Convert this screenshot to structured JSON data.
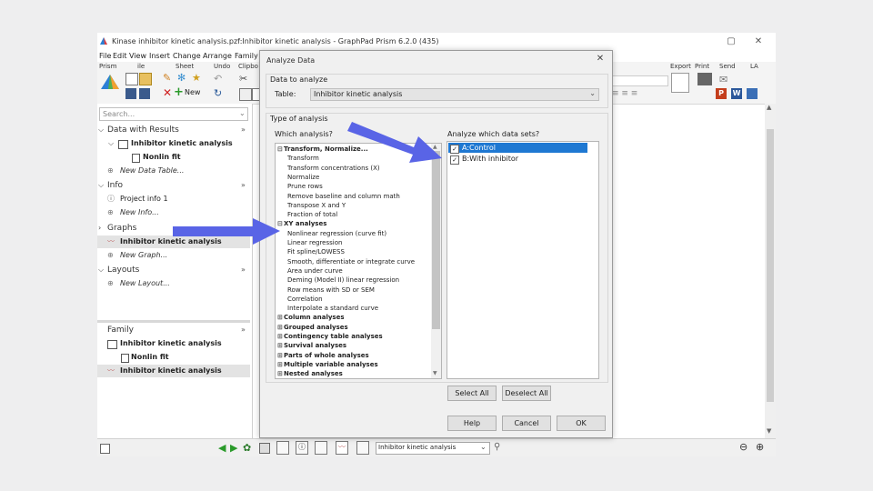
{
  "app": {
    "title": "Kinase inhibitor kinetic analysis.pzf:Inhibitor kinetic analysis - GraphPad Prism 6.2.0 (435)",
    "menu": [
      "File",
      "Edit",
      "View",
      "Insert",
      "Change",
      "Arrange",
      "Family"
    ],
    "ribbon_labels": {
      "prism": "Prism",
      "file": "ile",
      "sheet": "Sheet",
      "undo": "Undo",
      "clipboard": "Clipbo",
      "export": "Export",
      "print": "Print",
      "send": "Send",
      "la": "LA"
    },
    "new_label": "New"
  },
  "navigator": {
    "search_placeholder": "Search...",
    "sections": {
      "data": "Data with Results",
      "info": "Info",
      "graphs": "Graphs",
      "layouts": "Layouts",
      "family": "Family"
    },
    "data_table": "Inhibitor kinetic analysis",
    "nonlin_fit": "Nonlin fit",
    "new_data_table": "New Data Table...",
    "project_info": "Project info 1",
    "new_info": "New Info...",
    "graph_item": "Inhibitor kinetic analysis",
    "new_graph": "New Graph...",
    "new_layout": "New Layout...",
    "family_items": [
      "Inhibitor kinetic analysis",
      "Nonlin fit",
      "Inhibitor kinetic analysis"
    ],
    "collapse": "»"
  },
  "statusbar": {
    "sheet_select": "Inhibitor kinetic analysis"
  },
  "dialog": {
    "title": "Analyze Data",
    "data_to_analyze": "Data to analyze",
    "table_label": "Table:",
    "table_value": "Inhibitor kinetic analysis",
    "type_of_analysis": "Type of analysis",
    "which_analysis": "Which analysis?",
    "which_datasets": "Analyze which data sets?",
    "analyses": [
      {
        "label": "Transform, Normalize...",
        "cat": true,
        "sign": "⊟"
      },
      {
        "label": "Transform",
        "cat": false
      },
      {
        "label": "Transform concentrations (X)",
        "cat": false
      },
      {
        "label": "Normalize",
        "cat": false
      },
      {
        "label": "Prune rows",
        "cat": false
      },
      {
        "label": "Remove baseline and column math",
        "cat": false
      },
      {
        "label": "Transpose X and Y",
        "cat": false
      },
      {
        "label": "Fraction of total",
        "cat": false
      },
      {
        "label": "XY analyses",
        "cat": true,
        "sign": "⊟"
      },
      {
        "label": "Nonlinear regression (curve fit)",
        "cat": false
      },
      {
        "label": "Linear regression",
        "cat": false
      },
      {
        "label": "Fit spline/LOWESS",
        "cat": false
      },
      {
        "label": "Smooth, differentiate or integrate curve",
        "cat": false
      },
      {
        "label": "Area under curve",
        "cat": false
      },
      {
        "label": "Deming (Model II) linear regression",
        "cat": false
      },
      {
        "label": "Row means with SD or SEM",
        "cat": false
      },
      {
        "label": "Correlation",
        "cat": false
      },
      {
        "label": "Interpolate a standard curve",
        "cat": false
      },
      {
        "label": "Column analyses",
        "cat": true,
        "sign": "⊞"
      },
      {
        "label": "Grouped analyses",
        "cat": true,
        "sign": "⊞"
      },
      {
        "label": "Contingency table analyses",
        "cat": true,
        "sign": "⊞"
      },
      {
        "label": "Survival analyses",
        "cat": true,
        "sign": "⊞"
      },
      {
        "label": "Parts of whole analyses",
        "cat": true,
        "sign": "⊞"
      },
      {
        "label": "Multiple variable analyses",
        "cat": true,
        "sign": "⊞"
      },
      {
        "label": "Nested analyses",
        "cat": true,
        "sign": "⊞"
      }
    ],
    "datasets": [
      {
        "label": "A:Control",
        "checked": true,
        "selected": true
      },
      {
        "label": "B:With inhibitor",
        "checked": true,
        "selected": false
      }
    ],
    "select_all": "Select All",
    "deselect_all": "Deselect All",
    "help": "Help",
    "cancel": "Cancel",
    "ok": "OK",
    "close_glyph": "✕"
  },
  "colors": {
    "arrow": "#5964e6",
    "selection": "#1e78d2"
  }
}
